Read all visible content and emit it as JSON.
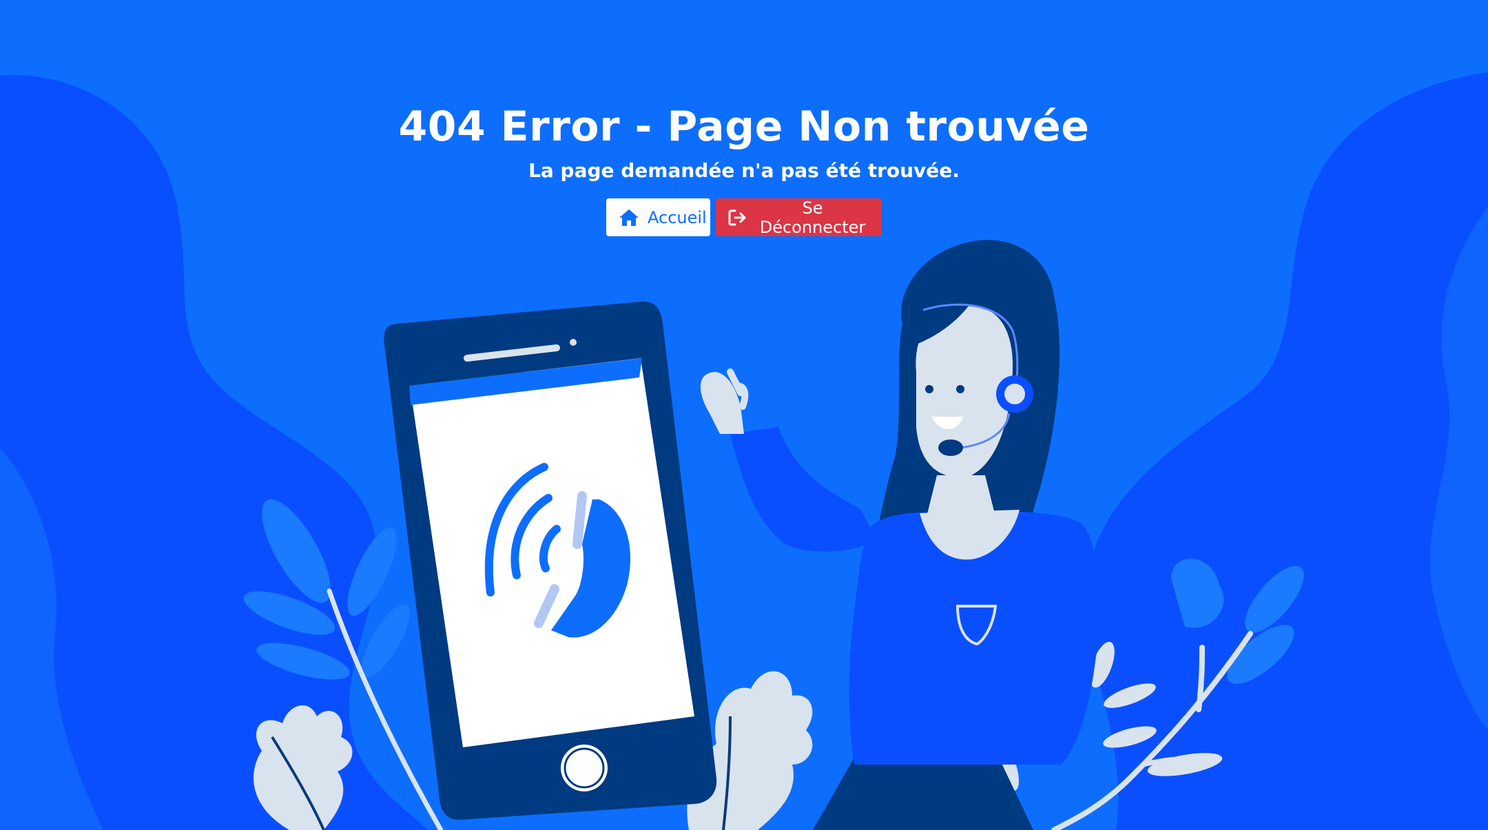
{
  "page": {
    "title": "404 Error - Page Non trouvée",
    "subtitle": "La page demandée n'a pas été trouvée."
  },
  "actions": {
    "home_label": "Accueil",
    "home_icon": "home-icon",
    "logout_label": "Se Déconnecter",
    "logout_icon": "sign-out-icon"
  },
  "colors": {
    "background": "#0d6efd",
    "home_button_bg": "#ffffff",
    "home_button_text": "#0d6efd",
    "logout_button_bg": "#dc3545"
  },
  "illustration": {
    "icons": [
      "phone-illustration",
      "phone-call-icon",
      "support-agent-illustration",
      "headset-icon",
      "leaf-decoration"
    ]
  }
}
